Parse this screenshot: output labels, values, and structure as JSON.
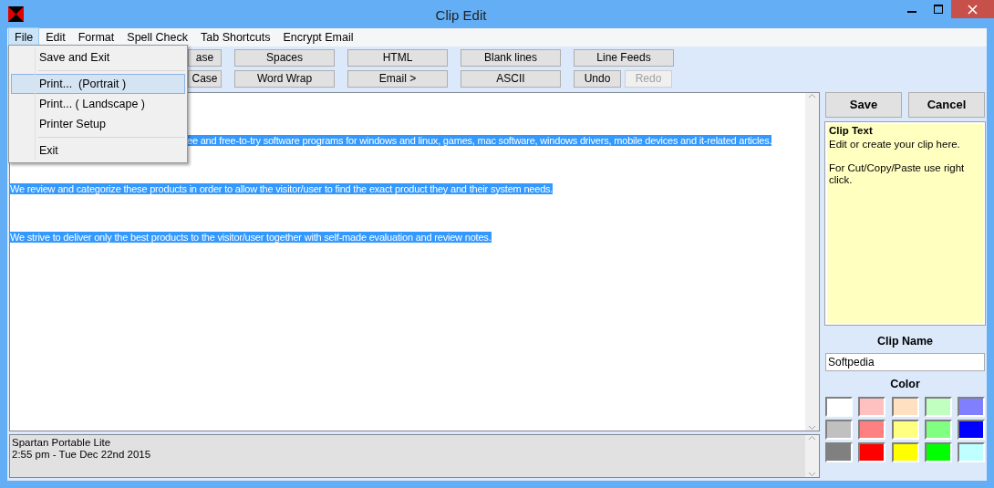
{
  "window": {
    "title": "Clip Edit"
  },
  "menu": [
    {
      "label": "File",
      "selected": true
    },
    {
      "label": "Edit",
      "selected": false
    },
    {
      "label": "Format",
      "selected": false
    },
    {
      "label": "Spell Check",
      "selected": false
    },
    {
      "label": "Tab Shortcuts",
      "selected": false
    },
    {
      "label": "Encrypt Email",
      "selected": false
    }
  ],
  "file_menu": [
    {
      "label": "Save and Exit",
      "selected": false,
      "separator_after": true
    },
    {
      "label": "Print...  (Portrait )",
      "selected": true,
      "separator_after": false
    },
    {
      "label": "Print... ( Landscape )",
      "selected": false,
      "separator_after": false
    },
    {
      "label": "Printer Setup",
      "selected": false,
      "separator_after": true
    },
    {
      "label": "Exit",
      "selected": false,
      "separator_after": false
    }
  ],
  "toolbar_rows": [
    [
      {
        "label": "ase",
        "disabled": false
      },
      {
        "label": "Spaces",
        "disabled": false
      },
      {
        "label": "HTML",
        "disabled": false
      },
      {
        "label": "Blank lines",
        "disabled": false
      },
      {
        "label": "Line Feeds",
        "disabled": false
      }
    ],
    [
      {
        "label": "Case",
        "disabled": false
      },
      {
        "label": "Word Wrap",
        "disabled": false
      },
      {
        "label": "Email >",
        "disabled": false
      },
      {
        "label": "ASCII",
        "disabled": false
      },
      {
        "label": "Undo",
        "disabled": false
      },
      {
        "label": "Redo",
        "disabled": true
      }
    ]
  ],
  "editor": {
    "lines": [
      "ee and free-to-try software programs for windows and linux, games, mac software, windows drivers, mobile devices and it-related articles.",
      "We review and categorize these products in order to allow the visitor/user to find the exact product they and their system needs.",
      "We strive to deliver only the best products to the visitor/user together with self-made evaluation and review notes."
    ]
  },
  "status": {
    "lines": [
      "Spartan Portable Lite",
      "2:55 pm - Tue Dec 22nd  2015"
    ]
  },
  "side": {
    "save": "Save",
    "cancel": "Cancel",
    "clip_text_title": "Clip Text",
    "clip_text_lines": [
      "Edit or create your clip here.",
      "For Cut/Copy/Paste use right click."
    ],
    "clip_name_label": "Clip Name",
    "clip_name": "Softpedia",
    "color_label": "Color",
    "colors": [
      {
        "color": "#ffffff"
      },
      {
        "color": "#ffc0c0"
      },
      {
        "color": "#ffe0c0"
      },
      {
        "color": "#c0ffc0"
      },
      {
        "color": "#8080ff"
      },
      {
        "color": "#c0c0c0"
      },
      {
        "color": "#ff8080"
      },
      {
        "color": "#ffff80"
      },
      {
        "color": "#80ff80"
      },
      {
        "color": "#0000ff"
      },
      {
        "color": "#808080"
      },
      {
        "color": "#ff0000"
      },
      {
        "color": "#ffff00"
      },
      {
        "color": "#00ff00"
      },
      {
        "color": "#c0ffff"
      }
    ]
  }
}
